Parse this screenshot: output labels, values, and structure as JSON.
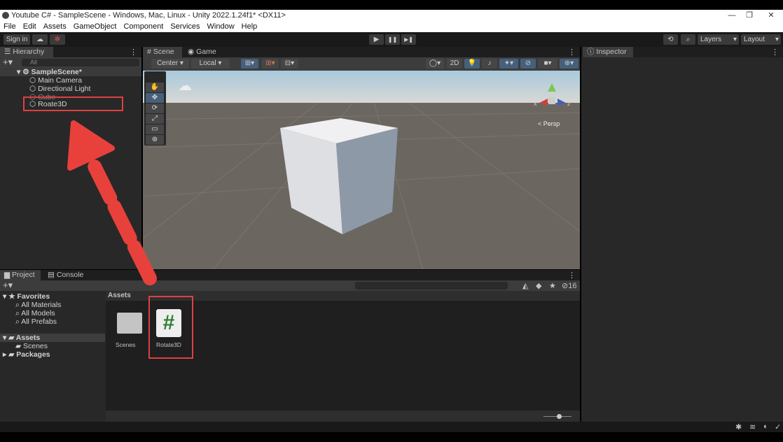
{
  "window": {
    "title": "Youtube C# - SampleScene - Windows, Mac, Linux - Unity 2022.1.24f1* <DX11>",
    "minimize": "—",
    "maximize": "❐",
    "close": "✕"
  },
  "menu": [
    "File",
    "Edit",
    "Assets",
    "GameObject",
    "Component",
    "Services",
    "Window",
    "Help"
  ],
  "toolbar": {
    "sign_in": "Sign in",
    "play": "▶",
    "pause": "❚❚",
    "step": "▶❚",
    "layers": "Layers",
    "layout": "Layout"
  },
  "hierarchy": {
    "tab": "Hierarchy",
    "search_placeholder": "All",
    "scene": "SampleScene*",
    "items": [
      "Main Camera",
      "Directional Light",
      "Cube",
      "Roate3D"
    ]
  },
  "scene": {
    "tabs": [
      "Scene",
      "Game"
    ],
    "pivot": "Center",
    "space": "Local",
    "mode_2d": "2D",
    "persp": "< Persp",
    "axes": {
      "x": "x",
      "y": "y",
      "z": "z"
    }
  },
  "inspector": {
    "tab": "Inspector"
  },
  "project": {
    "tabs": [
      "Project",
      "Console"
    ],
    "favorites": {
      "label": "Favorites",
      "items": [
        "All Materials",
        "All Models",
        "All Prefabs"
      ]
    },
    "tree": {
      "assets": "Assets",
      "scenes": "Scenes",
      "packages": "Packages"
    },
    "breadcrumb": "Assets",
    "hidden_count": "16",
    "assets": [
      {
        "name": "Scenes",
        "type": "folder"
      },
      {
        "name": "Rotate3D",
        "type": "csharp-script",
        "glyph": "#"
      }
    ]
  },
  "colors": {
    "highlight": "#e04040",
    "arrow": "#e8413c",
    "script_hash": "#2f7d32"
  }
}
